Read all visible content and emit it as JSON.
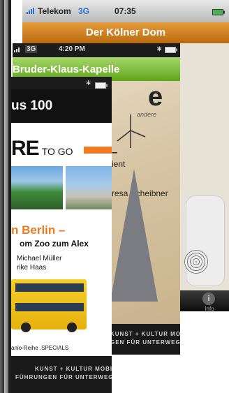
{
  "back_app": {
    "carrier": "Telekom",
    "network": "3G",
    "time": "07:35",
    "title": "Der Kölner Dom",
    "tab_info_label": "Info",
    "tab_info_icon": "i"
  },
  "middle_app": {
    "network": "3G",
    "time": "4:20 PM",
    "title": "Bruder-Klaus-Kapelle",
    "big_title_fragment": "e",
    "subtitle_fragment": "andere",
    "line_fragment_1": "–",
    "line_fragment_2": "ient",
    "author_fragment": "resa Scheibner",
    "footer_line1": "KUNST + KULTUR MOBIL",
    "footer_line2": "GEN FÜR UNTERWEGS"
  },
  "front_app": {
    "title": "us 100",
    "logo_re": "RE",
    "logo_togo": "TO GO",
    "heading": "n Berlin –",
    "subheading": "om Zoo zum Alex",
    "author1": "Michael Müller",
    "author2": "rike Haas",
    "series": "anio-Reihe .SPECIALS",
    "footer_line1": "KUNST + KULTUR MOBIL",
    "footer_line2": "FÜHRUNGEN FÜR UNTERWEGS"
  },
  "colors": {
    "orange_nav": "#d98624",
    "green_nav": "#7dc23d",
    "accent_orange": "#f07a22"
  }
}
